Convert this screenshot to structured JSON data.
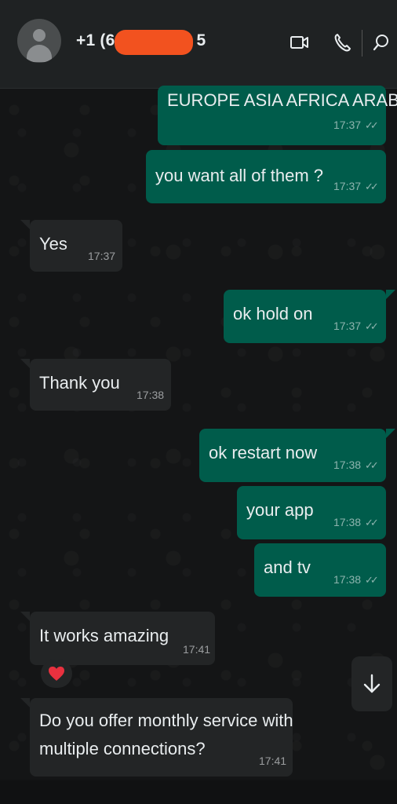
{
  "header": {
    "contact_name": "+1 (6",
    "contact_suffix": "5",
    "icons": [
      "avatar",
      "video-call-icon",
      "voice-call-icon",
      "search-icon"
    ]
  },
  "messages": [
    {
      "direction": "out",
      "text": "EUROPE ASIA AFRICA ARABE",
      "time": "17:37",
      "status": "read"
    },
    {
      "direction": "out",
      "text": "you want all of them ?",
      "time": "17:37",
      "status": "read"
    },
    {
      "direction": "in",
      "text": "Yes",
      "time": "17:37"
    },
    {
      "direction": "out",
      "text": "ok hold on",
      "time": "17:37",
      "status": "read"
    },
    {
      "direction": "in",
      "text": "Thank you",
      "time": "17:38"
    },
    {
      "direction": "out",
      "text": "ok restart now",
      "time": "17:38",
      "status": "read"
    },
    {
      "direction": "out",
      "text": "your app",
      "time": "17:38",
      "status": "read"
    },
    {
      "direction": "out",
      "text": "and tv",
      "time": "17:38",
      "status": "read"
    },
    {
      "direction": "in",
      "text": "It works amazing",
      "time": "17:41",
      "reaction": "heart"
    },
    {
      "direction": "in",
      "text_line1": "Do you offer monthly service with",
      "text_line2": "multiple connections?",
      "time": "17:41"
    }
  ],
  "colors": {
    "outgoing": "#005c4b",
    "incoming": "#232526",
    "header": "#1f2223",
    "redaction": "#f2521f"
  }
}
